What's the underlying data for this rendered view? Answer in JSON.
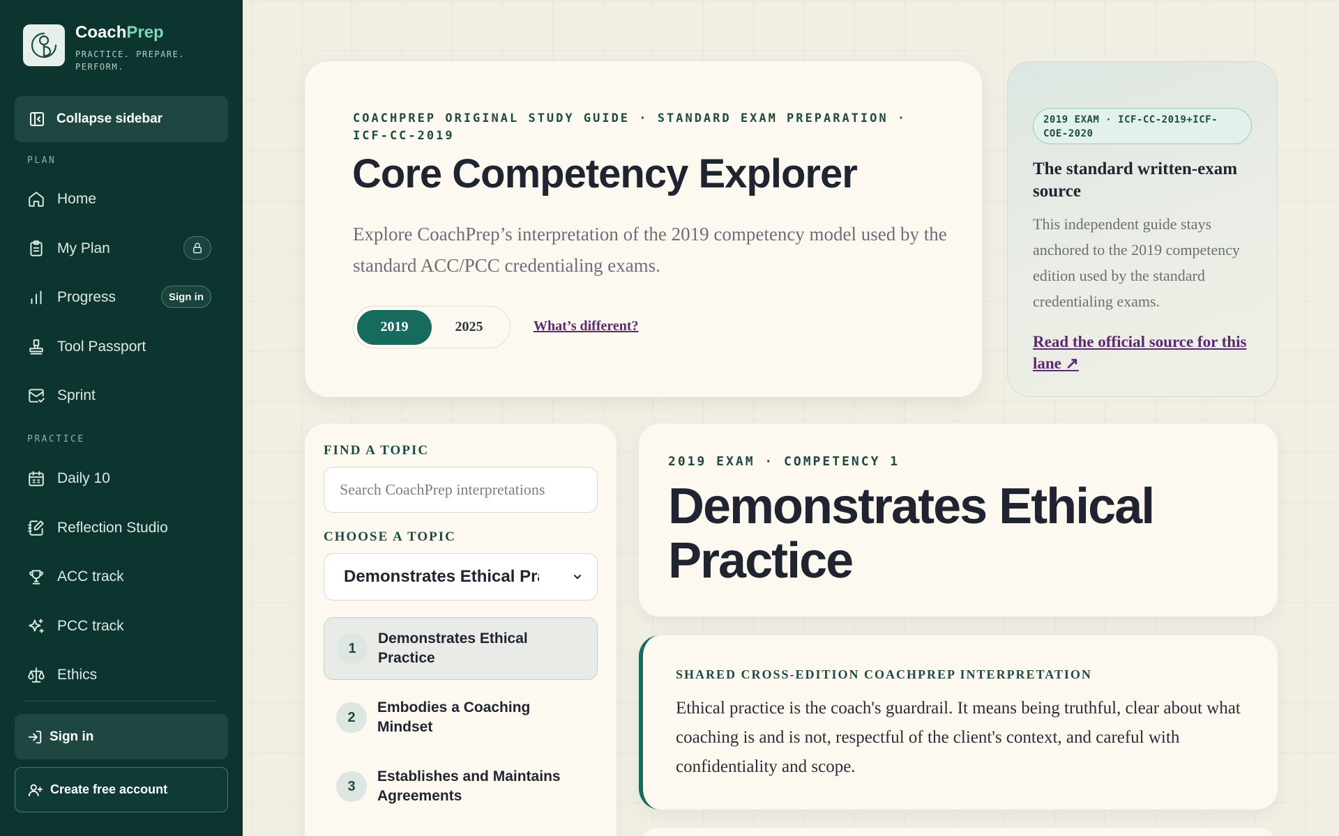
{
  "brand": {
    "name_part1": "Coach",
    "name_part2": "Prep",
    "tagline": "PRACTICE. PREPARE. PERFORM."
  },
  "sidebar": {
    "collapse_label": "Collapse sidebar",
    "sections": {
      "plan": "PLAN",
      "practice": "PRACTICE"
    },
    "plan_items": [
      {
        "label": "Home",
        "icon": "home-icon"
      },
      {
        "label": "My Plan",
        "icon": "clipboard-icon",
        "badge": "lock-icon"
      },
      {
        "label": "Progress",
        "icon": "bar-chart-icon",
        "badge": "Sign in"
      },
      {
        "label": "Tool Passport",
        "icon": "stamp-icon"
      },
      {
        "label": "Sprint",
        "icon": "mail-check-icon"
      }
    ],
    "practice_items": [
      {
        "label": "Daily 10",
        "icon": "calendar-icon"
      },
      {
        "label": "Reflection Studio",
        "icon": "notebook-pen-icon"
      },
      {
        "label": "ACC track",
        "icon": "trophy-icon"
      },
      {
        "label": "PCC track",
        "icon": "sparkles-icon"
      },
      {
        "label": "Ethics",
        "icon": "scale-icon"
      }
    ],
    "sign_in": "Sign in",
    "create_account": "Create free account"
  },
  "hero": {
    "eyebrow": "COACHPREP ORIGINAL STUDY GUIDE · STANDARD EXAM PREPARATION · ICF-CC-2019",
    "title": "Core Competency Explorer",
    "lede": "Explore CoachPrep’s interpretation of the 2019 competency model used by the standard ACC/PCC credentialing exams.",
    "years": [
      "2019",
      "2025"
    ],
    "active_year": "2019",
    "diff_link": "What’s different?"
  },
  "source_card": {
    "pill": "2019 EXAM · ICF-CC-2019+ICF-COE-2020",
    "title": "The standard written-exam source",
    "body": "This independent guide stays anchored to the 2019 competency edition used by the standard credentialing exams.",
    "link": "Read the official source for this lane ↗"
  },
  "topics": {
    "find_label": "FIND A TOPIC",
    "search_placeholder": "Search CoachPrep interpretations",
    "choose_label": "CHOOSE A TOPIC",
    "selected": "Demonstrates Ethical Practice",
    "items": [
      {
        "num": "1",
        "title": "Demonstrates Ethical Practice"
      },
      {
        "num": "2",
        "title": "Embodies a Coaching Mindset"
      },
      {
        "num": "3",
        "title": "Establishes and Maintains Agreements"
      }
    ]
  },
  "competency": {
    "eyebrow": "2019 EXAM · COMPETENCY 1",
    "title": "Demonstrates Ethical Practice"
  },
  "interpretation": {
    "label": "SHARED CROSS-EDITION COACHPREP INTERPRETATION",
    "body": "Ethical practice is the coach's guardrail. It means being truthful, clear about what coaching is and is not, respectful of the client's context, and careful with confidentiality and scope."
  },
  "colors": {
    "sidebar_bg": "#0c3530",
    "accent": "#176a5e",
    "brand_accent": "#7fd4b5",
    "link": "#5b2a6e",
    "page_bg": "#f1eee4",
    "card_bg": "#fdf8f0"
  }
}
